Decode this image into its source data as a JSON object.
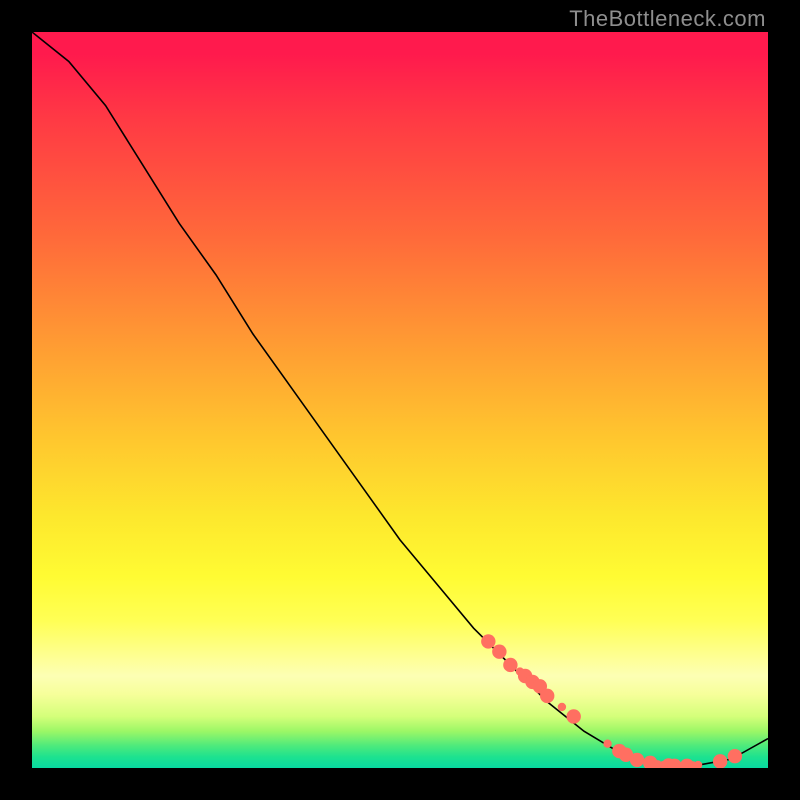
{
  "attribution": "TheBottleneck.com",
  "chart_data": {
    "type": "line",
    "title": "",
    "xlabel": "",
    "ylabel": "",
    "xlim": [
      0,
      100
    ],
    "ylim": [
      0,
      100
    ],
    "grid": false,
    "series": [
      {
        "name": "curve",
        "color": "#000000",
        "x": [
          0,
          5,
          10,
          15,
          20,
          25,
          30,
          35,
          40,
          45,
          50,
          55,
          60,
          65,
          70,
          75,
          80,
          85,
          90,
          95,
          100
        ],
        "values": [
          100,
          96,
          90,
          82,
          74,
          67,
          59,
          52,
          45,
          38,
          31,
          25,
          19,
          14,
          9,
          5,
          2,
          0.5,
          0.3,
          1.2,
          4
        ]
      }
    ],
    "markers": {
      "name": "highlight-points",
      "color": "#ff6f61",
      "radius_pattern": [
        "big",
        "big",
        "big",
        "small",
        "big",
        "big",
        "big",
        "big",
        "small",
        "big",
        "small",
        "big",
        "big",
        "big",
        "big",
        "small",
        "small",
        "big",
        "big",
        "big",
        "small",
        "small",
        "big",
        "big"
      ],
      "x": [
        62,
        63.5,
        65,
        66.3,
        67,
        68,
        69,
        70,
        72,
        73.6,
        78.2,
        79.8,
        80.7,
        82.2,
        84,
        85,
        85.8,
        86.5,
        87.3,
        89,
        89.8,
        90.5,
        93.5,
        95.5
      ],
      "values": [
        17.2,
        15.8,
        14,
        13.1,
        12.5,
        11.7,
        11.1,
        9.8,
        8.3,
        7,
        3.3,
        2.3,
        1.8,
        1.1,
        0.7,
        0.5,
        0.4,
        0.35,
        0.3,
        0.3,
        0.35,
        0.4,
        0.9,
        1.6
      ]
    }
  }
}
